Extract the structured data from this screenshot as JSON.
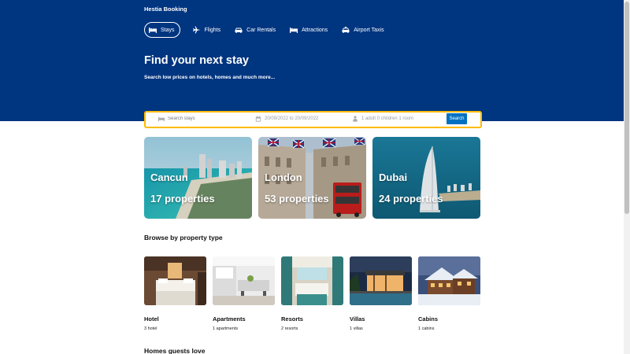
{
  "header": {
    "brand": "Hestia Booking",
    "nav": [
      {
        "label": "Stays",
        "icon": "bed-icon",
        "active": true
      },
      {
        "label": "Flights",
        "icon": "plane-icon"
      },
      {
        "label": "Car Rentals",
        "icon": "car-icon"
      },
      {
        "label": "Attractions",
        "icon": "bed-icon"
      },
      {
        "label": "Airport Taxis",
        "icon": "taxi-icon"
      }
    ],
    "title": "Find your next stay",
    "subtitle": "Search low prices on hotels, homes and much more..."
  },
  "search": {
    "destination_placeholder": "Search stays",
    "dates": "20/09/2022 to 20/09/2022",
    "guests": "1 adult 0 children 1 room",
    "button": "Search"
  },
  "featured": [
    {
      "city": "Cancun",
      "count": "17 properties"
    },
    {
      "city": "London",
      "count": "53 properties"
    },
    {
      "city": "Dubai",
      "count": "24 properties"
    }
  ],
  "property_types": {
    "title": "Browse by property type",
    "items": [
      {
        "name": "Hotel",
        "count": "3 hotel"
      },
      {
        "name": "Apartments",
        "count": "1 apartments"
      },
      {
        "name": "Resorts",
        "count": "2 resorts"
      },
      {
        "name": "Villas",
        "count": "1 villas"
      },
      {
        "name": "Cabins",
        "count": "1 cabins"
      }
    ]
  },
  "homes_title": "Homes guests love",
  "colors": {
    "brand_blue": "#003580",
    "search_border": "#febb02",
    "button_blue": "#0071c2"
  }
}
